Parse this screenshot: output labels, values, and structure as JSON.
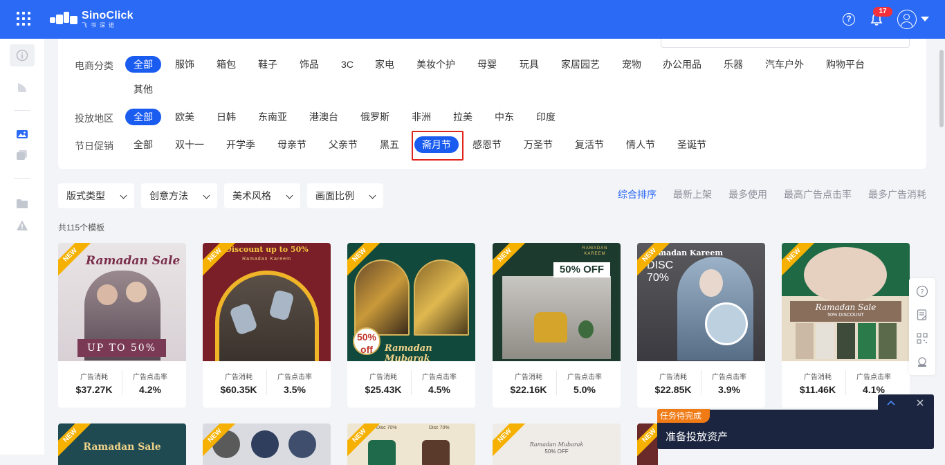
{
  "header": {
    "brand_name": "SinoClick",
    "brand_sub": "飞书深诺",
    "notification_count": "17",
    "icons": [
      "apps-grid-icon",
      "help-icon",
      "bell-icon",
      "user-avatar-icon",
      "chevron-down-icon"
    ]
  },
  "sidebar": {
    "icons": [
      "info-icon",
      "leaf-icon",
      "image-icon",
      "gallery-icon",
      "folder-icon",
      "warning-icon"
    ]
  },
  "filters": {
    "category": {
      "label": "电商分类",
      "options": [
        "全部",
        "服饰",
        "箱包",
        "鞋子",
        "饰品",
        "3C",
        "家电",
        "美妆个护",
        "母婴",
        "玩具",
        "家居园艺",
        "宠物",
        "办公用品",
        "乐器",
        "汽车户外",
        "购物平台",
        "其他"
      ],
      "selected": "全部"
    },
    "region": {
      "label": "投放地区",
      "options": [
        "全部",
        "欧美",
        "日韩",
        "东南亚",
        "港澳台",
        "俄罗斯",
        "非洲",
        "拉美",
        "中东",
        "印度"
      ],
      "selected": "全部"
    },
    "festival": {
      "label": "节日促销",
      "options": [
        "全部",
        "双十一",
        "开学季",
        "母亲节",
        "父亲节",
        "黑五",
        "斋月节",
        "感恩节",
        "万圣节",
        "复活节",
        "情人节",
        "圣诞节"
      ],
      "selected": "斋月节"
    }
  },
  "dropdowns": [
    {
      "label": "版式类型"
    },
    {
      "label": "创意方法"
    },
    {
      "label": "美术风格"
    },
    {
      "label": "画面比例"
    }
  ],
  "sort": {
    "options": [
      "综合排序",
      "最新上架",
      "最多使用",
      "最高广告点击率",
      "最多广告消耗"
    ],
    "active": "综合排序"
  },
  "result_count": "共115个模板",
  "cards": [
    {
      "badge": "NEW",
      "img_text": "Ramadan Sale",
      "img_sub": "UP TO 50%",
      "spend_label": "广告消耗",
      "spend": "$37.27K",
      "ctr_label": "广告点击率",
      "ctr": "4.2%"
    },
    {
      "badge": "NEW",
      "img_text": "Discount up to 50%",
      "img_sub": "Ramadan Kareem",
      "spend_label": "广告消耗",
      "spend": "$60.35K",
      "ctr_label": "广告点击率",
      "ctr": "3.5%"
    },
    {
      "badge": "NEW",
      "img_text": "Ramadan Mubarak",
      "img_sub": "50% off",
      "spend_label": "广告消耗",
      "spend": "$25.43K",
      "ctr_label": "广告点击率",
      "ctr": "4.5%"
    },
    {
      "badge": "NEW",
      "img_text": "50% OFF",
      "img_sub": "RAMADAN KAREEM",
      "spend_label": "广告消耗",
      "spend": "$22.16K",
      "ctr_label": "广告点击率",
      "ctr": "5.0%"
    },
    {
      "badge": "NEW",
      "img_text": "Ramadan Kareem",
      "img_sub": "DISC 70%",
      "spend_label": "广告消耗",
      "spend": "$22.85K",
      "ctr_label": "广告点击率",
      "ctr": "3.9%"
    },
    {
      "badge": "NEW",
      "img_text": "Ramadan Sale",
      "img_sub": "50% DISCOUNT",
      "spend_label": "广告消耗",
      "spend": "$11.46K",
      "ctr_label": "广告点击率",
      "ctr": "4.1%"
    }
  ],
  "cards_row2": [
    {
      "badge": "NEW",
      "img_text": "Ramadan Sale"
    },
    {
      "badge": "NEW",
      "img_text": ""
    },
    {
      "badge": "NEW",
      "img_text": "Disc 70%",
      "img_sub": "Disc 70%"
    },
    {
      "badge": "NEW",
      "img_text": "Ramadan Mubarak",
      "img_sub": "50% OFF"
    },
    {
      "badge": "NEW",
      "img_text": ""
    }
  ],
  "float_tools": [
    "help-circle-icon",
    "edit-note-icon",
    "qr-code-icon",
    "customer-service-icon"
  ],
  "task": {
    "tag": "任务待完成",
    "title": "准备投放资产"
  },
  "colors": {
    "brand_blue": "#2b6af5",
    "selected_chip": "#1a5cf0",
    "highlight_red": "#e0261c",
    "new_badge": "#f6b100",
    "task_bg": "#1b2540",
    "task_tag": "#f07a14"
  }
}
